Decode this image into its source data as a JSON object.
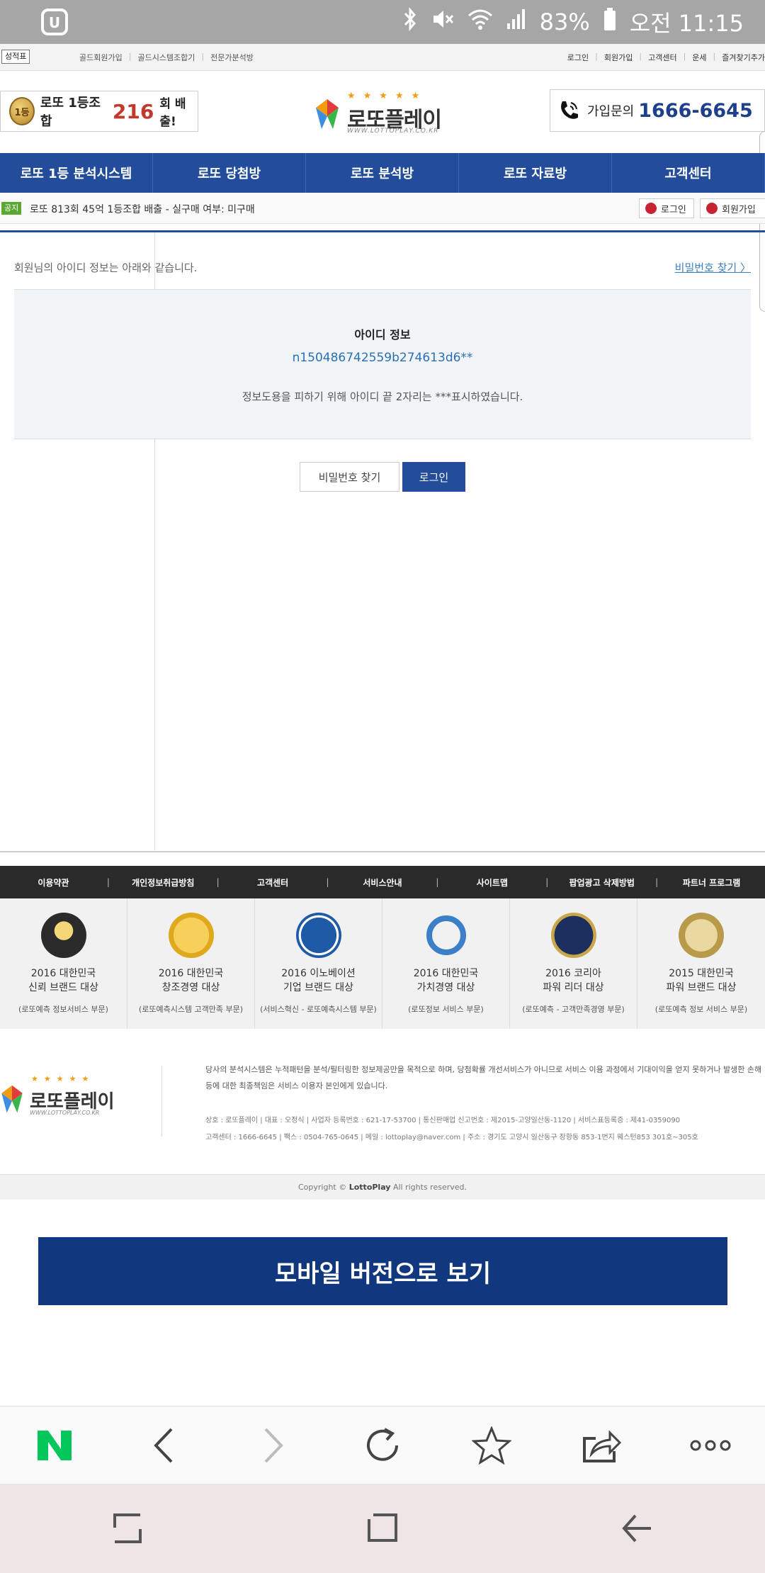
{
  "status_bar": {
    "battery": "83%",
    "time": "오전 11:15"
  },
  "top_bar": {
    "badge": "성적표",
    "left_links": [
      "골드회원가입",
      "골드시스템조합기",
      "전문가분석방"
    ],
    "right_links": [
      "로그인",
      "회원가입",
      "고객센터",
      "운세",
      "즐겨찾기추가"
    ]
  },
  "header": {
    "promo_medal": "1등",
    "promo_text": "로또 1등조합",
    "promo_number": "216",
    "promo_suffix": "회 배출!",
    "logo_name": "로또플레이",
    "logo_url": "WWW.LOTTOPLAY.CO.KR",
    "phone_label": "가입문의",
    "phone_number": "1666-6645"
  },
  "nav": [
    "로또 1등 분석시스템",
    "로또 당첨방",
    "로또 분석방",
    "로또 자료방",
    "고객센터"
  ],
  "notice": {
    "tag": "공지",
    "text": "로또 813회 45억 1등조합 배출 - 실구매 여부: 미구매",
    "login_btn": "로그인",
    "join_btn": "회원가입"
  },
  "main": {
    "intro": "회원님의 아이디 정보는 아래와 같습니다.",
    "find_pw_link": "비밀번호 찾기 〉",
    "info_title": "아이디 정보",
    "user_id": "n150486742559b274613d6**",
    "info_note": "정보도용을 피하기 위해 아이디 끝 2자리는 ***표시하였습니다.",
    "find_pw_button": "비밀번호 찾기",
    "login_button": "로그인"
  },
  "footer_links": [
    "이용약관",
    "개인정보취급방침",
    "고객센터",
    "서비스안내",
    "사이트맵",
    "팝업광고 삭제방법",
    "파트너 프로그램"
  ],
  "awards": [
    {
      "line1": "2016 대한민국",
      "line2": "신뢰 브랜드 대상",
      "sub": "(로또예측 정보서비스 부문)",
      "color": "#2b2b2b",
      "icon": "trophy-award-icon"
    },
    {
      "line1": "2016 대한민국",
      "line2": "창조경영 대상",
      "sub": "(로또예측시스템 고객만족 부문)",
      "color": "#e0a81e",
      "icon": "gold-seal-icon"
    },
    {
      "line1": "2016 이노베이션",
      "line2": "기업 브랜드 대상",
      "sub": "(서비스혁신 - 로또예측시스템 부문)",
      "color": "#1f5aa6",
      "icon": "blue-seal-icon"
    },
    {
      "line1": "2016 대한민국",
      "line2": "가치경영 대상",
      "sub": "(로또정보 서비스 부문)",
      "color": "#3a7fc8",
      "icon": "ring-award-icon"
    },
    {
      "line1": "2016 코리아",
      "line2": "파워 리더 대상",
      "sub": "(로또예측 - 고객만족경영 부문)",
      "color": "#1c2f5e",
      "icon": "power-leader-icon"
    },
    {
      "line1": "2015 대한민국",
      "line2": "파워 브랜드 대상",
      "sub": "(로또예측 정보 서비스 부문)",
      "color": "#b89a4a",
      "icon": "gold-medal-icon"
    }
  ],
  "company": {
    "description": "당사의 분석시스템은 누적패턴을 분석/필터링한 정보제공만을 목적으로 하며, 당첨확률 개선서비스가 아니므로 서비스 이용 과정에서 기대이익을 얻지 못하거나 발생한 손해 등에 대한 최종책임은 서비스 이용자 본인에게 있습니다.",
    "info_line1": "상호 : 로또플레이 | 대표 : 오정식 | 사업자 등록번호 : 621-17-53700 | 통신판매업 신고번호 : 제2015-고양일산동-1120 | 서비스표등록증 : 제41-0359090",
    "info_line2": "고객센터 : 1666-6645 | 팩스 : 0504-765-0645 | 메일 : lottoplay@naver.com | 주소 : 경기도 고양시 일산동구 장항동 853-1번지 웨스턴853 301호~305호"
  },
  "copyright": {
    "prefix": "Copyright ©",
    "brand": "LottoPlay",
    "suffix": "All rights reserved."
  },
  "mobile_button": "모바일 버전으로 보기",
  "colors": {
    "nav_blue": "#234d9a",
    "accent_red": "#c0392b",
    "mobile_btn": "#11387f",
    "naver_green": "#03c75a"
  }
}
